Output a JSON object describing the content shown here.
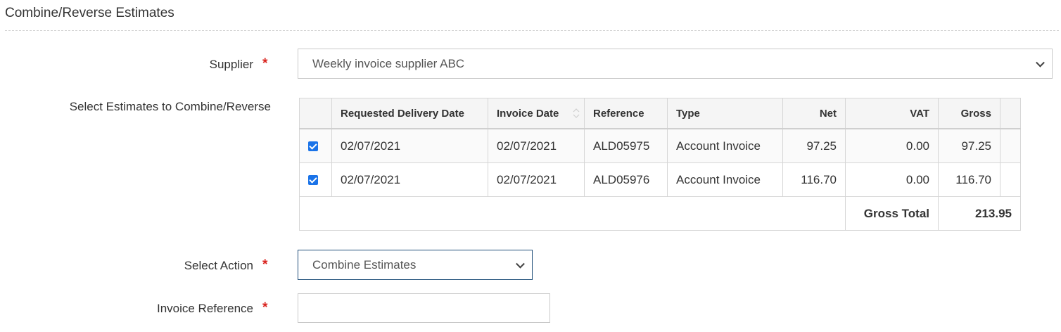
{
  "page": {
    "title": "Combine/Reverse Estimates"
  },
  "supplier": {
    "label": "Supplier",
    "required_mark": "*",
    "value": "Weekly invoice supplier ABC"
  },
  "estimates": {
    "label": "Select Estimates to Combine/Reverse",
    "columns": [
      "",
      "Requested Delivery Date",
      "Invoice Date",
      "Reference",
      "Type",
      "Net",
      "VAT",
      "Gross",
      ""
    ],
    "rows": [
      {
        "checked": true,
        "delivery_date": "02/07/2021",
        "invoice_date": "02/07/2021",
        "reference": "ALD05975",
        "type": "Account Invoice",
        "net": "97.25",
        "vat": "0.00",
        "gross": "97.25"
      },
      {
        "checked": true,
        "delivery_date": "02/07/2021",
        "invoice_date": "02/07/2021",
        "reference": "ALD05976",
        "type": "Account Invoice",
        "net": "116.70",
        "vat": "0.00",
        "gross": "116.70"
      }
    ],
    "total_label": "Gross Total",
    "total_value": "213.95"
  },
  "action": {
    "label": "Select Action",
    "required_mark": "*",
    "value": "Combine Estimates"
  },
  "invoice_ref": {
    "label": "Invoice Reference",
    "required_mark": "*",
    "value": ""
  },
  "colors": {
    "required": "#d9231e",
    "vat": "#d9231e",
    "checkbox": "#1a73e8",
    "focus_border": "#1f4e79"
  }
}
